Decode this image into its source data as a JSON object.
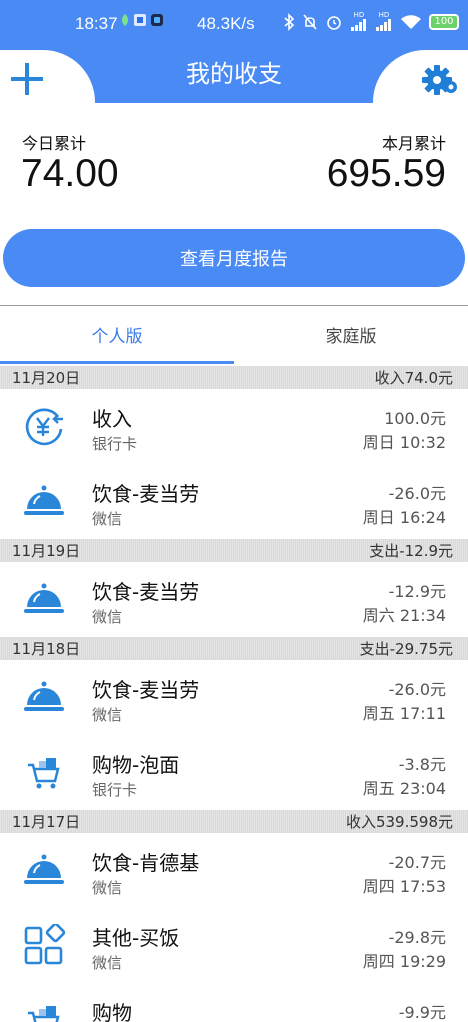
{
  "status_bar": {
    "time": "18:37",
    "net_speed": "48.3K/s",
    "signal_labels": [
      "HD",
      "HD"
    ],
    "battery": "100"
  },
  "header": {
    "title": "我的收支"
  },
  "summary": {
    "today_label": "今日累计",
    "today_value": "74.00",
    "month_label": "本月累计",
    "month_value": "695.59",
    "report_button": "查看月度报告"
  },
  "tabs": {
    "personal": "个人版",
    "family": "家庭版"
  },
  "days": [
    {
      "date": "11月20日",
      "total": "收入74.0元",
      "items": [
        {
          "icon": "yuan-income-icon",
          "category": "收入",
          "account": "银行卡",
          "amount": "100.0元",
          "time": "周日 10:32"
        },
        {
          "icon": "food-cloche-icon",
          "category": "饮食-麦当劳",
          "account": "微信",
          "amount": "-26.0元",
          "time": "周日 16:24"
        }
      ]
    },
    {
      "date": "11月19日",
      "total": "支出-12.9元",
      "items": [
        {
          "icon": "food-cloche-icon",
          "category": "饮食-麦当劳",
          "account": "微信",
          "amount": "-12.9元",
          "time": "周六 21:34"
        }
      ]
    },
    {
      "date": "11月18日",
      "total": "支出-29.75元",
      "items": [
        {
          "icon": "food-cloche-icon",
          "category": "饮食-麦当劳",
          "account": "微信",
          "amount": "-26.0元",
          "time": "周五 17:11"
        },
        {
          "icon": "shopping-cart-icon",
          "category": "购物-泡面",
          "account": "银行卡",
          "amount": "-3.8元",
          "time": "周五 23:04"
        }
      ]
    },
    {
      "date": "11月17日",
      "total": "收入539.598元",
      "items": [
        {
          "icon": "food-cloche-icon",
          "category": "饮食-肯德基",
          "account": "微信",
          "amount": "-20.7元",
          "time": "周四 17:53"
        },
        {
          "icon": "other-grid-icon",
          "category": "其他-买饭",
          "account": "微信",
          "amount": "-29.8元",
          "time": "周四 19:29"
        },
        {
          "icon": "shopping-cart-icon",
          "category": "购物",
          "account": "",
          "amount": "-9.9元",
          "time": ""
        }
      ]
    }
  ],
  "colors": {
    "accent": "#4a8af5",
    "icon_blue": "#2a86d8"
  }
}
